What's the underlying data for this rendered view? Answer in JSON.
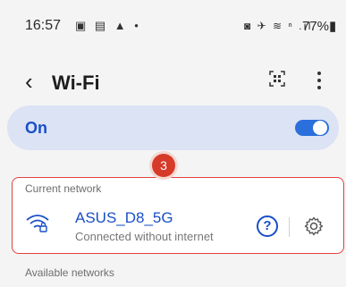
{
  "status_bar": {
    "time": "16:57",
    "left_icons": "▣ ▤ ▲ •",
    "right_icons": "◙ ✈ ≋ ⁿ .ıl",
    "battery": "77%▮"
  },
  "header": {
    "title": "Wi-Fi"
  },
  "wifi_toggle": {
    "label": "On",
    "state": true
  },
  "annotation": {
    "badge": "3"
  },
  "current_network": {
    "section_label": "Current network",
    "name": "ASUS_D8_5G",
    "status": "Connected without internet"
  },
  "available_networks": {
    "section_label": "Available networks"
  },
  "colors": {
    "accent": "#1a4ec8",
    "highlight": "#e24040",
    "badge": "#d63a28"
  }
}
